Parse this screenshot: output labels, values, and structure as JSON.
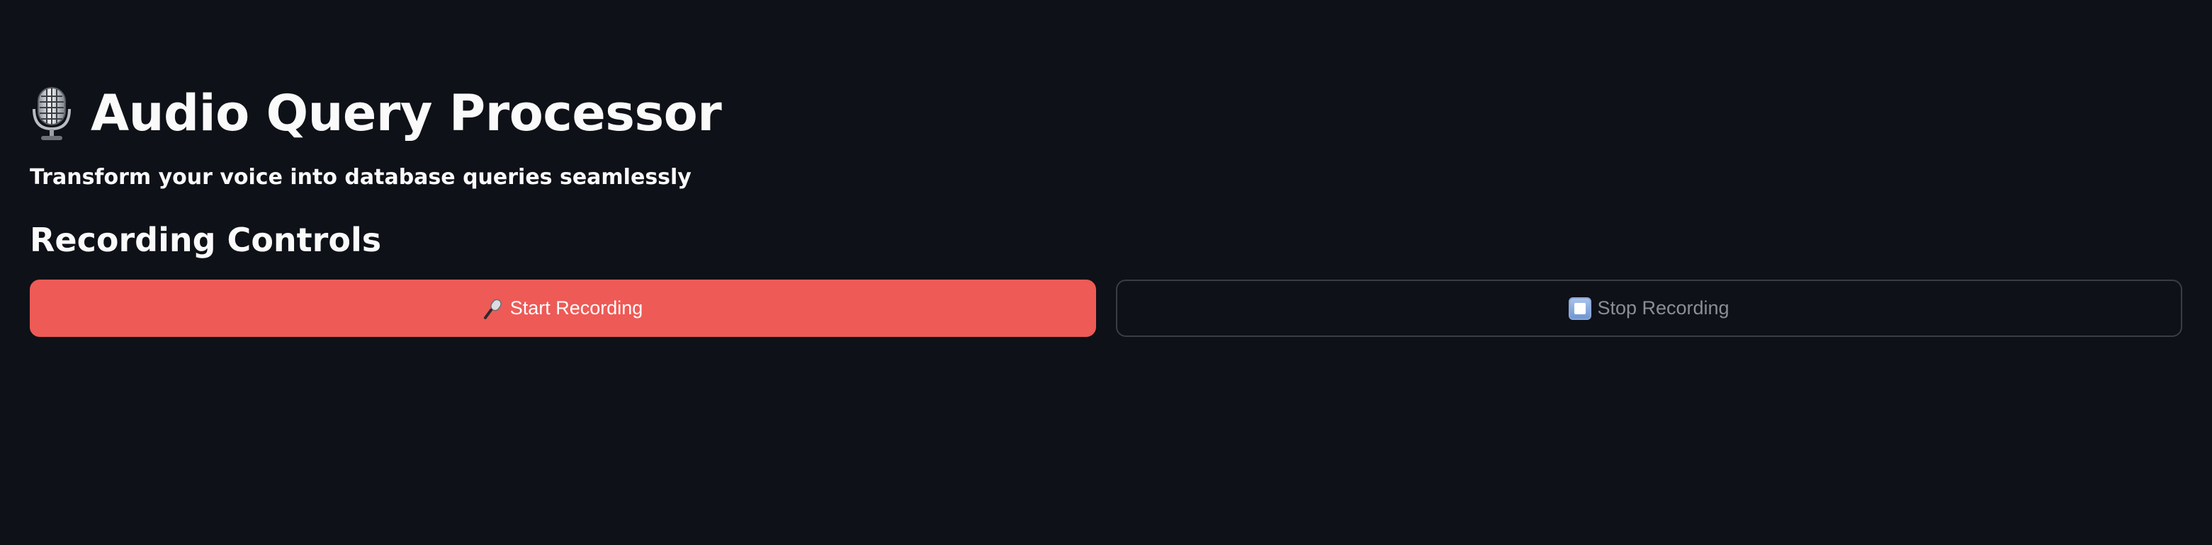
{
  "app": {
    "title": "Audio Query Processor",
    "title_icon": "studio-microphone-icon",
    "subtitle": "Transform your voice into database queries seamlessly"
  },
  "recording": {
    "section_title": "Recording Controls",
    "start_button": {
      "label": "Start Recording",
      "icon": "microphone-icon",
      "color": "#ee5a56"
    },
    "stop_button": {
      "label": "Stop Recording",
      "icon": "stop-button-icon",
      "disabled": true
    }
  },
  "colors": {
    "background": "#0e1117",
    "text": "#fafafa",
    "primary": "#ee5a56",
    "disabled_text": "#8b8e96",
    "border": "#3a3d45"
  }
}
